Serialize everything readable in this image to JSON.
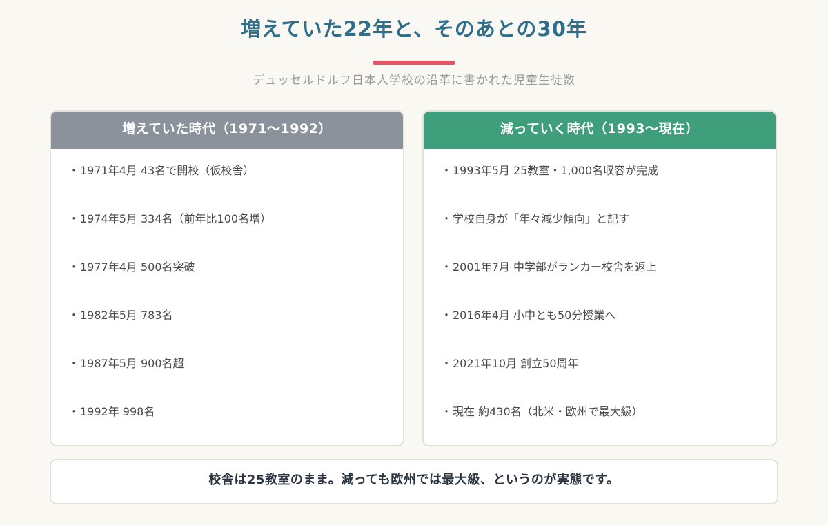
{
  "title": "増えていた22年と、そのあとの30年",
  "subtitle": "デュッセルドルフ日本人学校の沿革に書かれた児童生徒数",
  "colors": {
    "title": "#2f6f8e",
    "accent_underline": "#e05563",
    "left_header": "#8b929c",
    "right_header": "#3f9e7c"
  },
  "bullet": "・",
  "left_panel": {
    "heading": "増えていた時代（1971〜1992）",
    "items": [
      "1971年4月 43名で開校（仮校舎）",
      "1974年5月 334名（前年比100名増）",
      "1977年4月 500名突破",
      "1982年5月 783名",
      "1987年5月 900名超",
      "1992年 998名"
    ]
  },
  "right_panel": {
    "heading": "減っていく時代（1993〜現在）",
    "items": [
      "1993年5月 25教室・1,000名収容が完成",
      "学校自身が「年々減少傾向」と記す",
      "2001年7月 中学部がランカー校舎を返上",
      "2016年4月 小中とも50分授業へ",
      "2021年10月 創立50周年",
      "現在 約430名（北米・欧州で最大級）"
    ]
  },
  "summary": "校舎は25教室のまま。減っても欧州では最大級、というのが実態です。"
}
